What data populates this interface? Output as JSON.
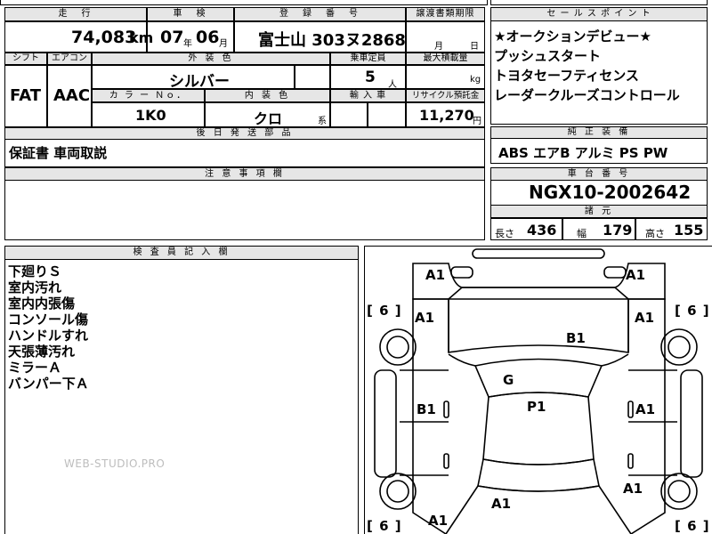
{
  "top_labels": {
    "mileage": "走　行",
    "inspection": "車　検",
    "registration": "登　録　番　号",
    "transfer_deadline": "譲渡書類期限",
    "sales_points": "セ ー ル ス ポ イ ン ト"
  },
  "mileage": {
    "value": "74,083",
    "unit": "km"
  },
  "inspection": {
    "year": "07",
    "year_unit": "年",
    "month": "06",
    "month_unit": "月"
  },
  "registration": {
    "plate": "富士山 303ヌ2868"
  },
  "transfer_deadline": {
    "month_unit": "月",
    "day_unit": "日"
  },
  "sales_points": [
    "★オークションデビュー★",
    "プッシュスタート",
    "トヨタセーフティセンス",
    "レーダークルーズコントロール"
  ],
  "row2_labels": {
    "shift": "シフト",
    "aircon": "エアコン",
    "exterior_color": "外 装 色",
    "capacity": "乗車定員",
    "max_load": "最大積載量"
  },
  "shift": "FAT",
  "aircon": "AAC",
  "exterior_color": "シルバー",
  "capacity": {
    "value": "5",
    "unit": "人"
  },
  "max_load": {
    "unit": "kg"
  },
  "row3_labels": {
    "color_no": "カ ラ ー Ｎｏ．",
    "interior_color": "内 装 色",
    "import": "輸 入 車",
    "recycle": "リサイクル預託金"
  },
  "color_no": "1K0",
  "interior_color": {
    "value": "クロ",
    "suffix": "系"
  },
  "recycle": {
    "value": "11,270",
    "unit": "円"
  },
  "later_parts": {
    "label": "後 日 発 送 部 品",
    "text": "保証書 車両取説"
  },
  "genuine_equipment": {
    "label": "純 正 装 備",
    "text": "ABS エアB アルミ PS PW"
  },
  "notes": {
    "label": "注 意 事 項 欄"
  },
  "chassis": {
    "label": "車 台 番 号",
    "value": "NGX10-2002642"
  },
  "specs": {
    "label": "諸 元",
    "length_label": "長さ",
    "length": "436",
    "width_label": "幅",
    "width": "179",
    "height_label": "高さ",
    "height": "155"
  },
  "inspector": {
    "label": "検 査 員 記 入 欄",
    "lines": [
      "下廻りＳ",
      "室内汚れ",
      "室内内張傷",
      "コンソール傷",
      "ハンドルすれ",
      "天張薄汚れ",
      "ミラーＡ",
      "バンパー下Ａ"
    ]
  },
  "watermark": "WEB-STUDIO.PRO",
  "diagram": {
    "tire_bracket": "[ 6 ]",
    "marks": {
      "front_left": "A1",
      "front_right": "A1",
      "fender_left": "A1",
      "fender_right": "A1",
      "hood": "B1",
      "windshield": "G",
      "roof": "P1",
      "door_left": "B1",
      "door_right": "A1",
      "quarter_right": "A1",
      "trunk": "A1",
      "rear_left": "A1"
    }
  }
}
